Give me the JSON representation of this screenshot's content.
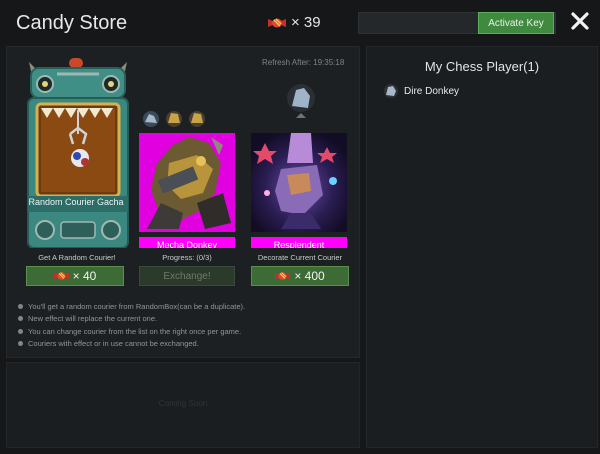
{
  "header": {
    "title": "Candy Store",
    "candy_count": "× 39",
    "activate_label": "Activate Key"
  },
  "store": {
    "refresh": "Refresh After: 19:35:18",
    "gacha": {
      "label": "Random Courier Gacha",
      "caption": "Get A Random Courier!",
      "price": "× 40"
    },
    "mecha": {
      "label": "Mecha Donkey",
      "caption": "Progress: (0/3)",
      "button": "Exchange!"
    },
    "resplendent": {
      "label": "Resplendent",
      "caption": "Decorate Current Courier",
      "price": "× 400"
    },
    "rules": [
      "You'll get a random courier from RandomBox(can be a duplicate).",
      "New effect will replace the current one.",
      "You can change courier from the list on the right once per game.",
      "Couriers with effect or in use cannot be exchanged."
    ],
    "coming_soon": "Coming Soon"
  },
  "side": {
    "title": "My Chess Player(1)",
    "players": [
      "Dire Donkey"
    ]
  },
  "colors": {
    "accent_green": "#3f8a3f",
    "card_label_magenta": "#ff00ff",
    "machine_teal": "#3f8f86"
  }
}
